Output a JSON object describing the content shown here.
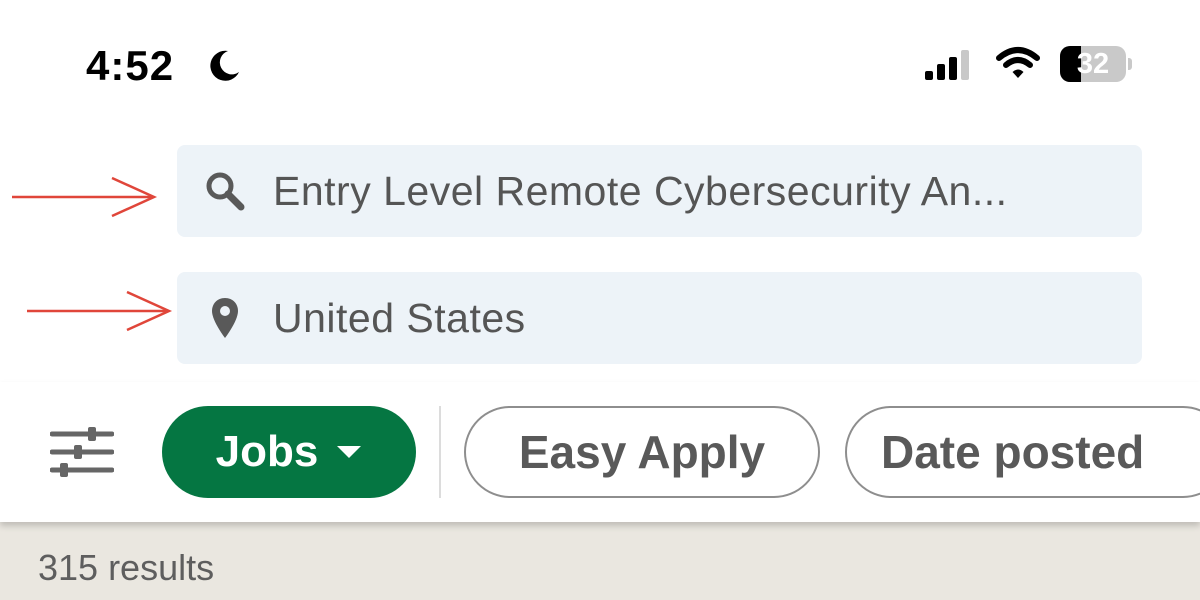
{
  "status_bar": {
    "time": "4:52",
    "focus_icon": "moon-icon",
    "signal_icon": "cellular-signal-icon",
    "wifi_icon": "wifi-icon",
    "battery_level": "32",
    "battery_fraction": 0.32
  },
  "search": {
    "keyword_icon": "search-icon",
    "keyword_value": "Entry Level Remote Cybersecurity An...",
    "location_icon": "location-pin-icon",
    "location_value": "United States"
  },
  "annotations": {
    "arrow_color": "#e0463a"
  },
  "filters": {
    "filter_icon": "sliders-icon",
    "jobs_label": "Jobs",
    "easy_apply_label": "Easy Apply",
    "date_posted_label": "Date posted"
  },
  "results": {
    "count_text": "315 results"
  },
  "colors": {
    "accent_green": "#057642",
    "field_background": "#edf3f8",
    "results_background": "#eae7e0"
  }
}
